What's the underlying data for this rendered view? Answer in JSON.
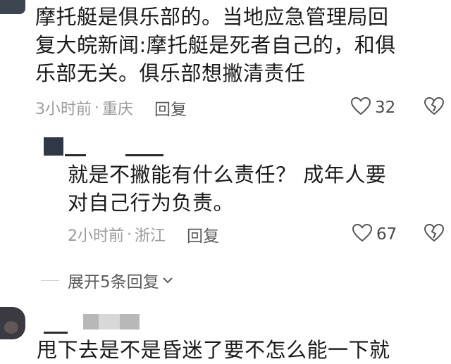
{
  "comment1": {
    "text_line1": "摩托艇是俱乐部的。当地应急管理局回",
    "text_line2": "复大皖新闻:摩托艇是死者自己的，和俱",
    "text_line3": "乐部无关。俱乐部想撇清责任",
    "time": "3小时前",
    "location": "重庆",
    "reply_label": "回复",
    "like_count": "32"
  },
  "reply1": {
    "text_line1": "就是不撇能有什么责任？  成年人要",
    "text_line2": "对自己行为负责。",
    "time": "2小时前",
    "location": "浙江",
    "reply_label": "回复",
    "like_count": "67"
  },
  "expand": {
    "label": "展开5条回复"
  },
  "comment2": {
    "text_line1": "甩下去是不是昏迷了要不怎么能一下就"
  },
  "icons": {
    "like": "heart-outline-icon",
    "dislike": "broken-heart-icon",
    "expand": "chevron-down-icon"
  }
}
